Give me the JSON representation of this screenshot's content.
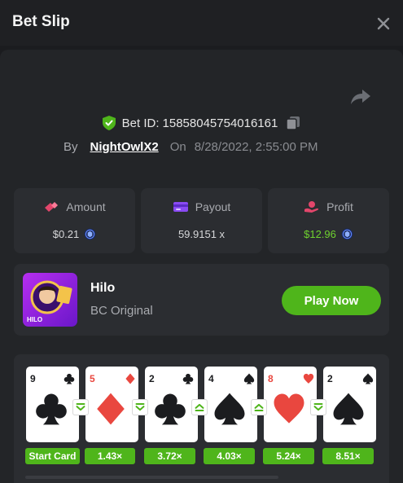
{
  "header": {
    "title": "Bet Slip"
  },
  "bet": {
    "id_label": "Bet ID:",
    "id": "15858045754016161",
    "by_label": "By",
    "user": "NightOwlX2",
    "on_label": "On",
    "date": "8/28/2022, 2:55:00 PM"
  },
  "stats": {
    "amount": {
      "label": "Amount",
      "value": "$0.21"
    },
    "payout": {
      "label": "Payout",
      "value": "59.9151 x"
    },
    "profit": {
      "label": "Profit",
      "value": "$12.96"
    }
  },
  "game": {
    "name": "Hilo",
    "subtitle": "BC Original",
    "play_label": "Play Now",
    "thumb_text": "HILO"
  },
  "cards": [
    {
      "rank": "9",
      "suit": "club",
      "color": "#1b1c1f",
      "label": "Start Card"
    },
    {
      "rank": "5",
      "suit": "diamond",
      "color": "#e9473f",
      "label": "1.43×",
      "dir": "down"
    },
    {
      "rank": "2",
      "suit": "club",
      "color": "#1b1c1f",
      "label": "3.72×",
      "dir": "down"
    },
    {
      "rank": "4",
      "suit": "spade",
      "color": "#1b1c1f",
      "label": "4.03×",
      "dir": "up"
    },
    {
      "rank": "8",
      "suit": "heart",
      "color": "#e9473f",
      "label": "5.24×",
      "dir": "up"
    },
    {
      "rank": "2",
      "suit": "spade",
      "color": "#1b1c1f",
      "label": "8.51×",
      "dir": "down"
    }
  ],
  "colors": {
    "accent": "#4fb51b",
    "profit": "#6fd22f",
    "panel": "#2b2d31"
  },
  "icons": [
    "close-icon",
    "share-icon",
    "shield-check-icon",
    "copy-icon",
    "amount-icon",
    "payout-card-icon",
    "profit-hand-icon",
    "coin-icon"
  ]
}
